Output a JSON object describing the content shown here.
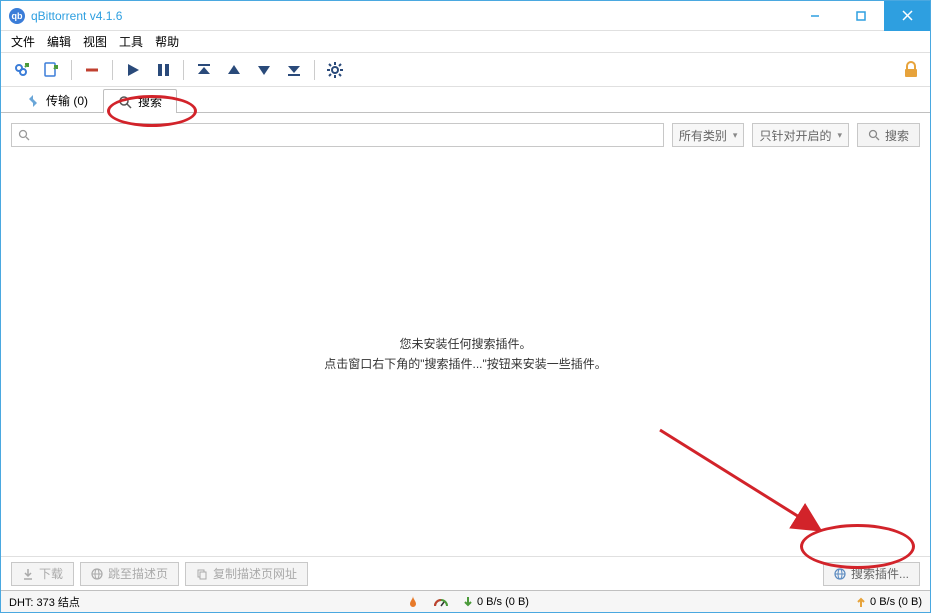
{
  "window": {
    "title": "qBittorrent v4.1.6"
  },
  "menus": {
    "file": "文件",
    "edit": "编辑",
    "view": "视图",
    "tools": "工具",
    "help": "帮助"
  },
  "tabs": {
    "transfers": "传输 (0)",
    "search": "搜索"
  },
  "search": {
    "placeholder": "",
    "category": "所有类别",
    "target": "只针对开启的",
    "button": "搜索"
  },
  "empty": {
    "line1": "您未安装任何搜索插件。",
    "line2": "点击窗口右下角的\"搜索插件...\"按钮来安装一些插件。"
  },
  "footer": {
    "download": "下载",
    "gotoDesc": "跳至描述页",
    "copyDesc": "复制描述页网址",
    "plugins": "搜索插件..."
  },
  "status": {
    "dht": "DHT: 373 结点",
    "down": "0 B/s (0 B)",
    "up": "0 B/s (0 B)"
  },
  "colors": {
    "accent": "#2e9fe0",
    "anno": "#d2232a",
    "green": "#4a9a39",
    "orange": "#e7a33b"
  }
}
